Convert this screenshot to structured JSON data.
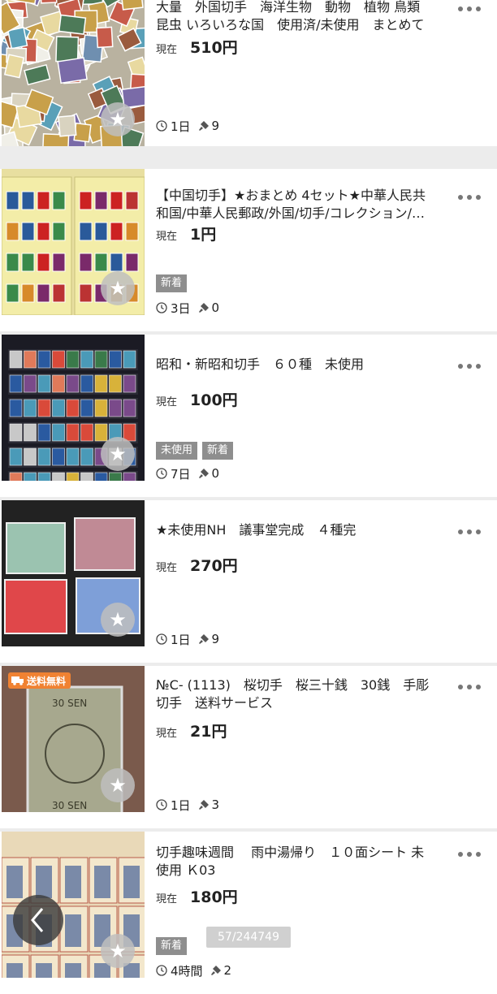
{
  "listing": {
    "items": [
      {
        "title": "大量　外国切手　海洋生物　動物　植物 鳥類\n昆虫 いろいろな国　使用済/未使用　まとめて",
        "price_label": "現在",
        "price": "510円",
        "tags": [],
        "time_left": "1日",
        "bids": "9",
        "thumb_icon": "stamp-pile-image",
        "shipping_badge": ""
      },
      {
        "title": "【中国切手】★おまとめ 4セット★中華人民共\n和国/中華人民郵政/外国/切手/コレクション/…",
        "price_label": "現在",
        "price": "1円",
        "tags": [
          "新着"
        ],
        "time_left": "3日",
        "bids": "0",
        "thumb_icon": "stamp-album-image",
        "shipping_badge": ""
      },
      {
        "title": "昭和・新昭和切手　６０種　未使用",
        "price_label": "現在",
        "price": "100円",
        "tags": [
          "未使用",
          "新着"
        ],
        "time_left": "7日",
        "bids": "0",
        "thumb_icon": "stamp-stockbook-image",
        "shipping_badge": ""
      },
      {
        "title": "★未使用NH　議事堂完成　４種完",
        "price_label": "現在",
        "price": "270円",
        "tags": [],
        "time_left": "1日",
        "bids": "9",
        "thumb_icon": "diet-building-stamps-image",
        "shipping_badge": ""
      },
      {
        "title": "№C- (1113)　桜切手　桜三十銭　30銭　手彫\n切手　送料サービス",
        "price_label": "現在",
        "price": "21円",
        "tags": [],
        "time_left": "1日",
        "bids": "3",
        "thumb_icon": "sakura-stamp-image",
        "shipping_badge": "送料無料"
      },
      {
        "title": "切手趣味週間　 雨中湯帰り　１０面シート 未\n使用 Ｋ03",
        "price_label": "現在",
        "price": "180円",
        "tags": [
          "新着"
        ],
        "time_left": "4時間",
        "bids": "2",
        "thumb_icon": "stamp-sheet-image",
        "shipping_badge": ""
      }
    ]
  },
  "overlay": {
    "counter": "57/244749",
    "back_icon": "chevron-left-icon"
  },
  "colors": {
    "badge_orange": "#f08232",
    "tag_gray": "#8e8e8e",
    "separator": "#ececec"
  }
}
